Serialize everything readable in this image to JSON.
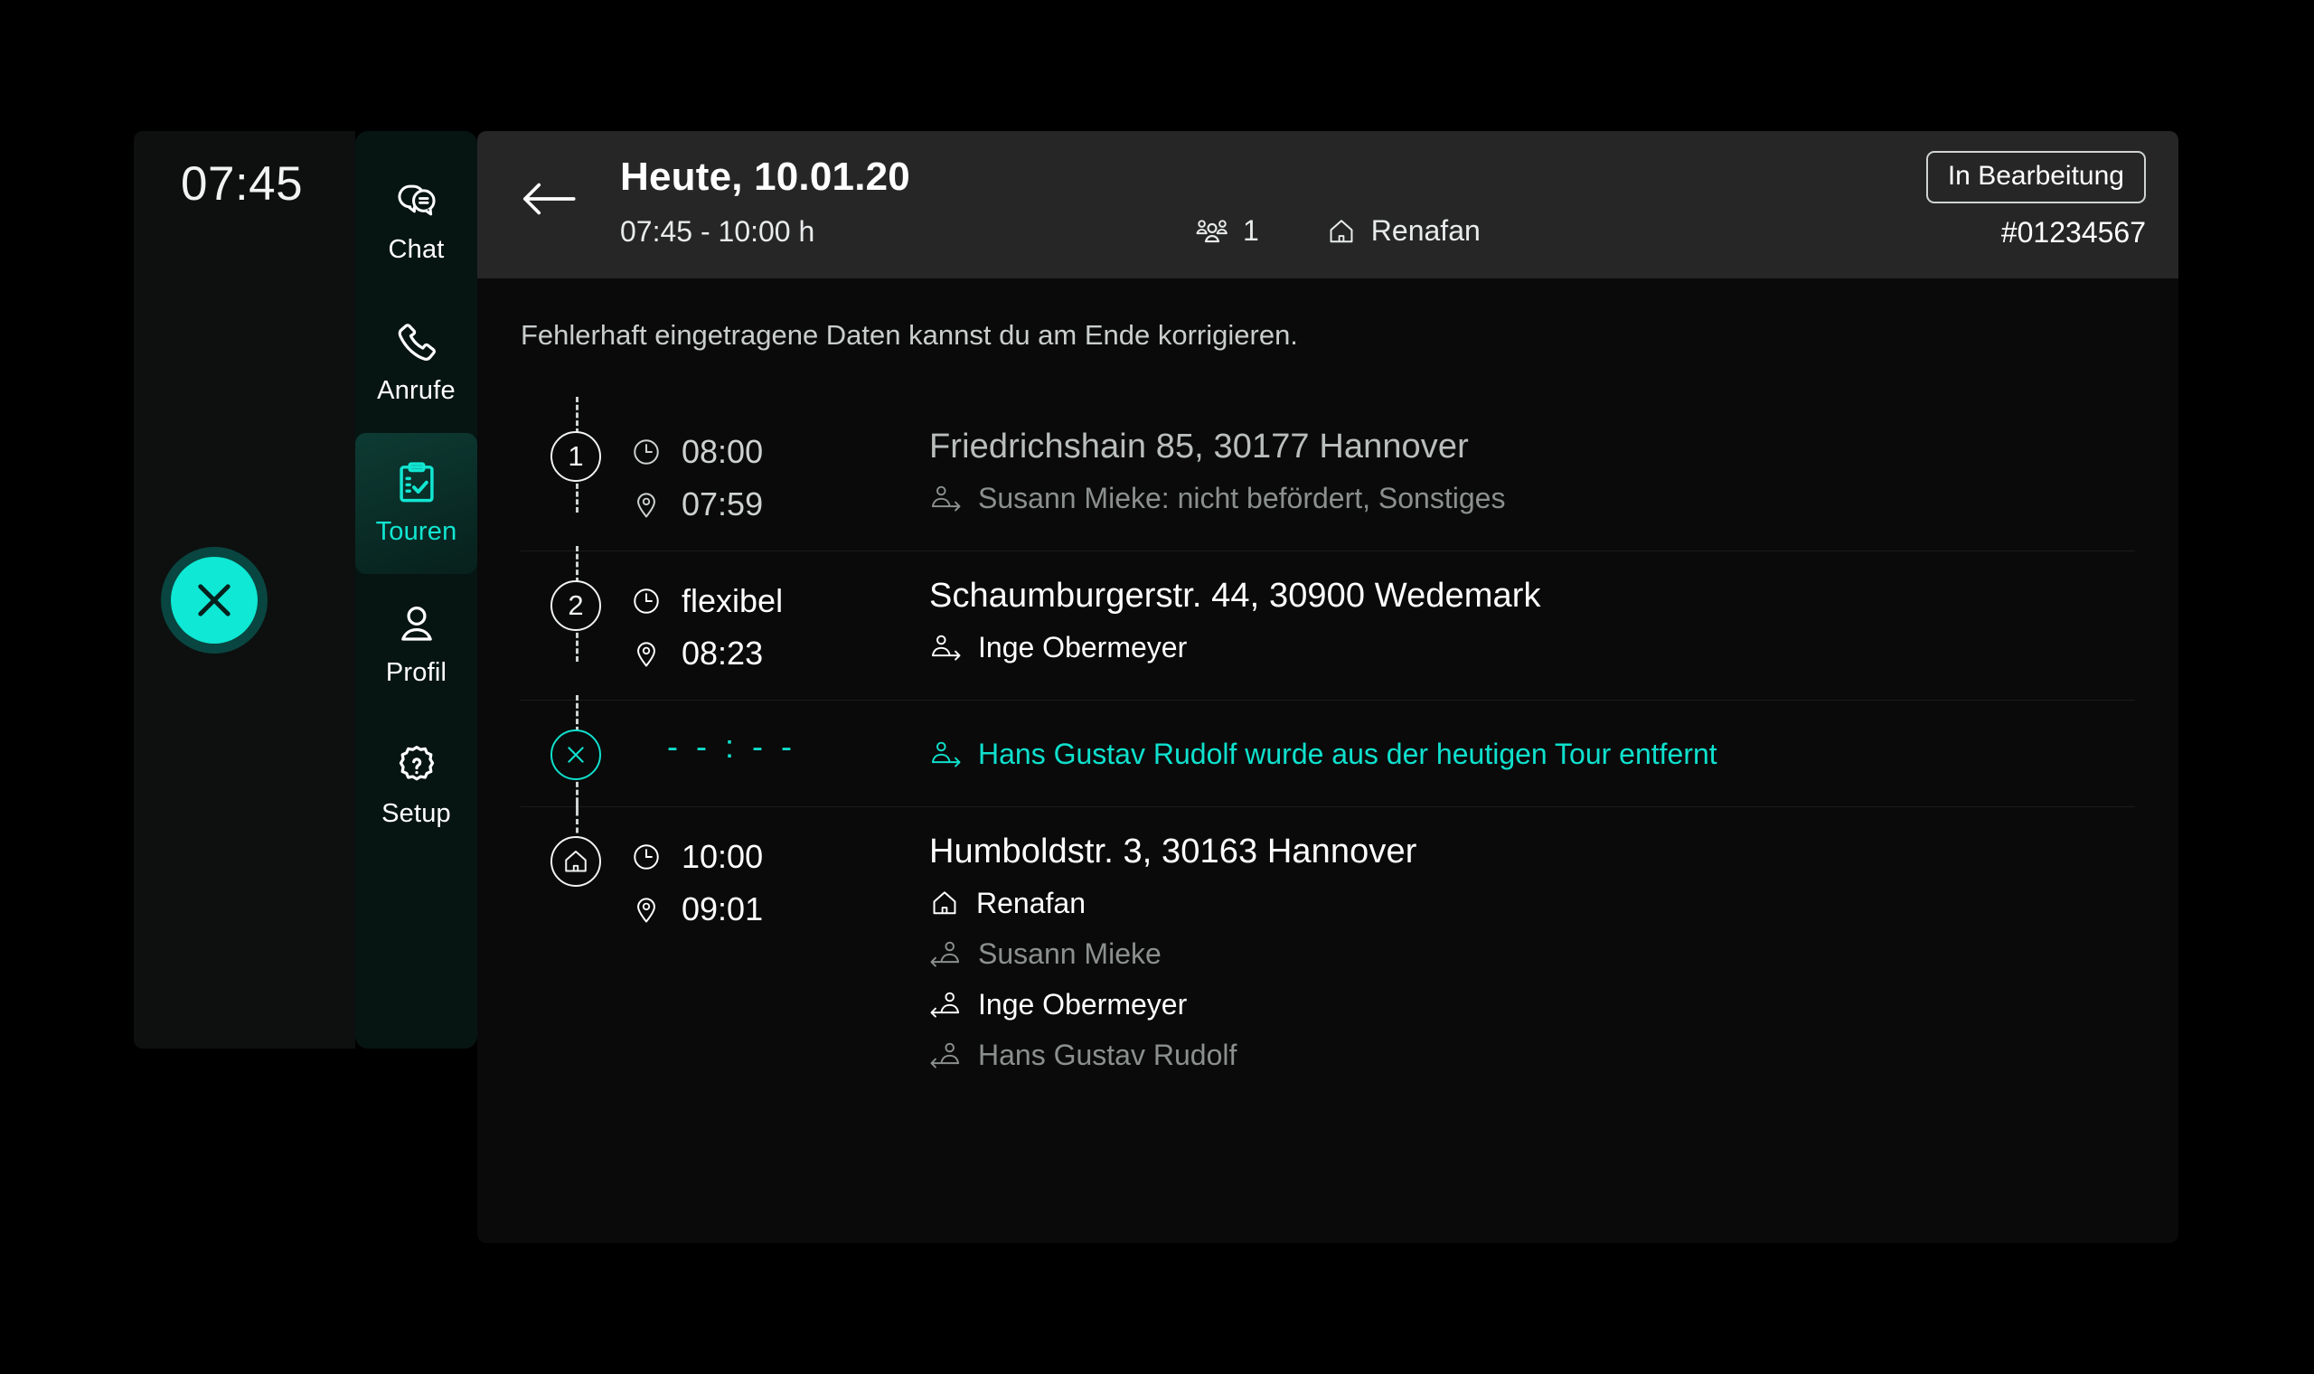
{
  "clock": {
    "time": "07:45"
  },
  "fab": {
    "icon": "close-icon",
    "color": "#0fe8d4"
  },
  "sidebar": {
    "items": [
      {
        "label": "Chat",
        "icon": "chat-icon",
        "active": false
      },
      {
        "label": "Anrufe",
        "icon": "phone-icon",
        "active": false
      },
      {
        "label": "Touren",
        "icon": "clipboard-check-icon",
        "active": true
      },
      {
        "label": "Profil",
        "icon": "user-icon",
        "active": false
      },
      {
        "label": "Setup",
        "icon": "gear-help-icon",
        "active": false
      }
    ],
    "active_color": "#12e6d2"
  },
  "header": {
    "back_icon": "arrow-left-icon",
    "title": "Heute, 10.01.20",
    "time_range": "07:45 - 10:00 h",
    "passengers_icon": "group-icon",
    "passengers_count": "1",
    "home_icon": "home-icon",
    "company": "Renafan",
    "status_badge": "In Bearbeitung",
    "order_id": "#01234567"
  },
  "notice": "Fehlerhaft eingetragene Daten kannst du am Ende korrigieren.",
  "timeline": {
    "stops": [
      {
        "marker": "1",
        "marker_type": "number",
        "planned_time": "08:00",
        "actual_time": "07:59",
        "address": "Friedrichshain 85, 30177 Hannover",
        "people": [
          {
            "name": "Susann Mieke: nicht befördert, Sonstiges",
            "icon": "passenger-pickup-icon",
            "tone": "dim"
          }
        ]
      },
      {
        "marker": "2",
        "marker_type": "number",
        "planned_time": "flexibel",
        "actual_time": "08:23",
        "address": "Schaumburgerstr. 44, 30900 Wedemark",
        "people": [
          {
            "name": "Inge Obermeyer",
            "icon": "passenger-pickup-icon",
            "tone": "white"
          }
        ]
      },
      {
        "marker": "",
        "marker_type": "removed",
        "planned_time": "",
        "actual_time": "",
        "empty_time": "- - : - -",
        "address": "",
        "people": [
          {
            "name": "Hans Gustav Rudolf wurde aus der heutigen Tour entfernt",
            "icon": "passenger-pickup-icon",
            "tone": "teal"
          }
        ]
      },
      {
        "marker": "",
        "marker_type": "home",
        "planned_time": "10:00",
        "actual_time": "09:01",
        "address": "Humboldstr. 3, 30163 Hannover",
        "people": [
          {
            "name": "Renafan",
            "icon": "home-icon",
            "tone": "white"
          },
          {
            "name": "Susann Mieke",
            "icon": "passenger-dropoff-icon",
            "tone": "dim"
          },
          {
            "name": "Inge Obermeyer",
            "icon": "passenger-dropoff-icon",
            "tone": "white"
          },
          {
            "name": "Hans Gustav Rudolf",
            "icon": "passenger-dropoff-icon",
            "tone": "dim"
          }
        ]
      }
    ],
    "icons": {
      "planned": "clock-icon",
      "actual": "map-pin-icon"
    }
  }
}
